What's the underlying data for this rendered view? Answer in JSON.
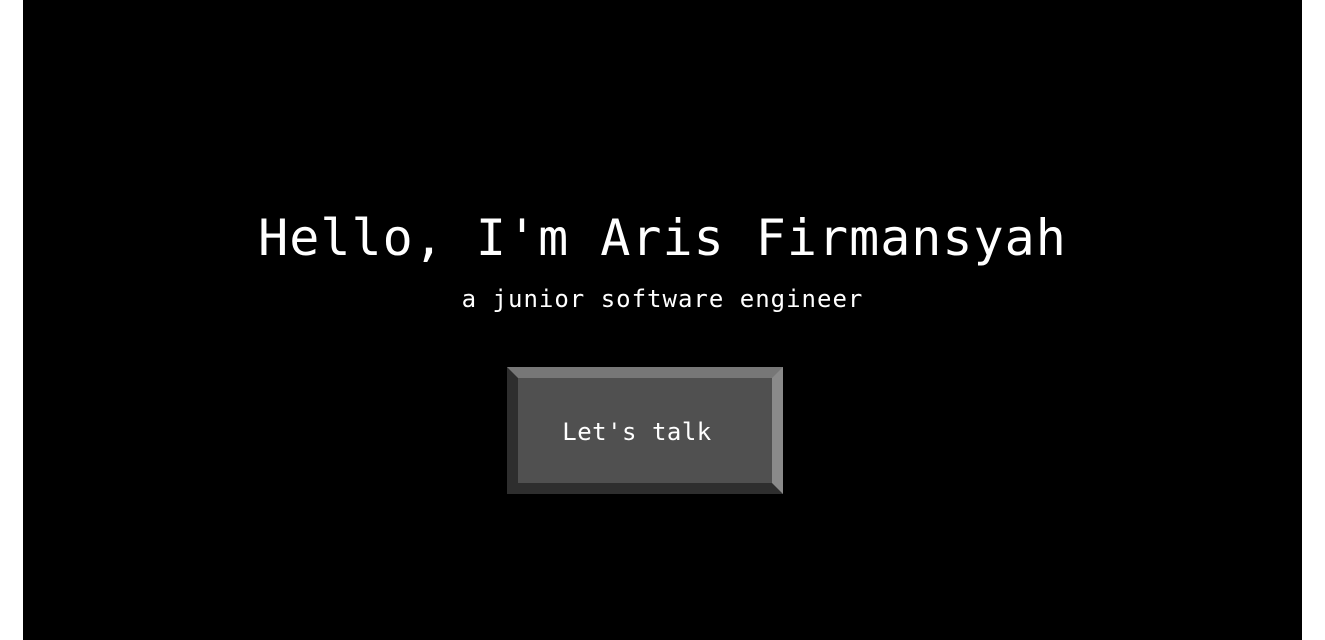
{
  "hero": {
    "title": "Hello, I'm Aris Firmansyah",
    "subtitle": "a junior software engineer",
    "cta_label": "Let's talk"
  },
  "colors": {
    "background": "#000000",
    "text": "#ffffff",
    "button_face": "#505050"
  }
}
